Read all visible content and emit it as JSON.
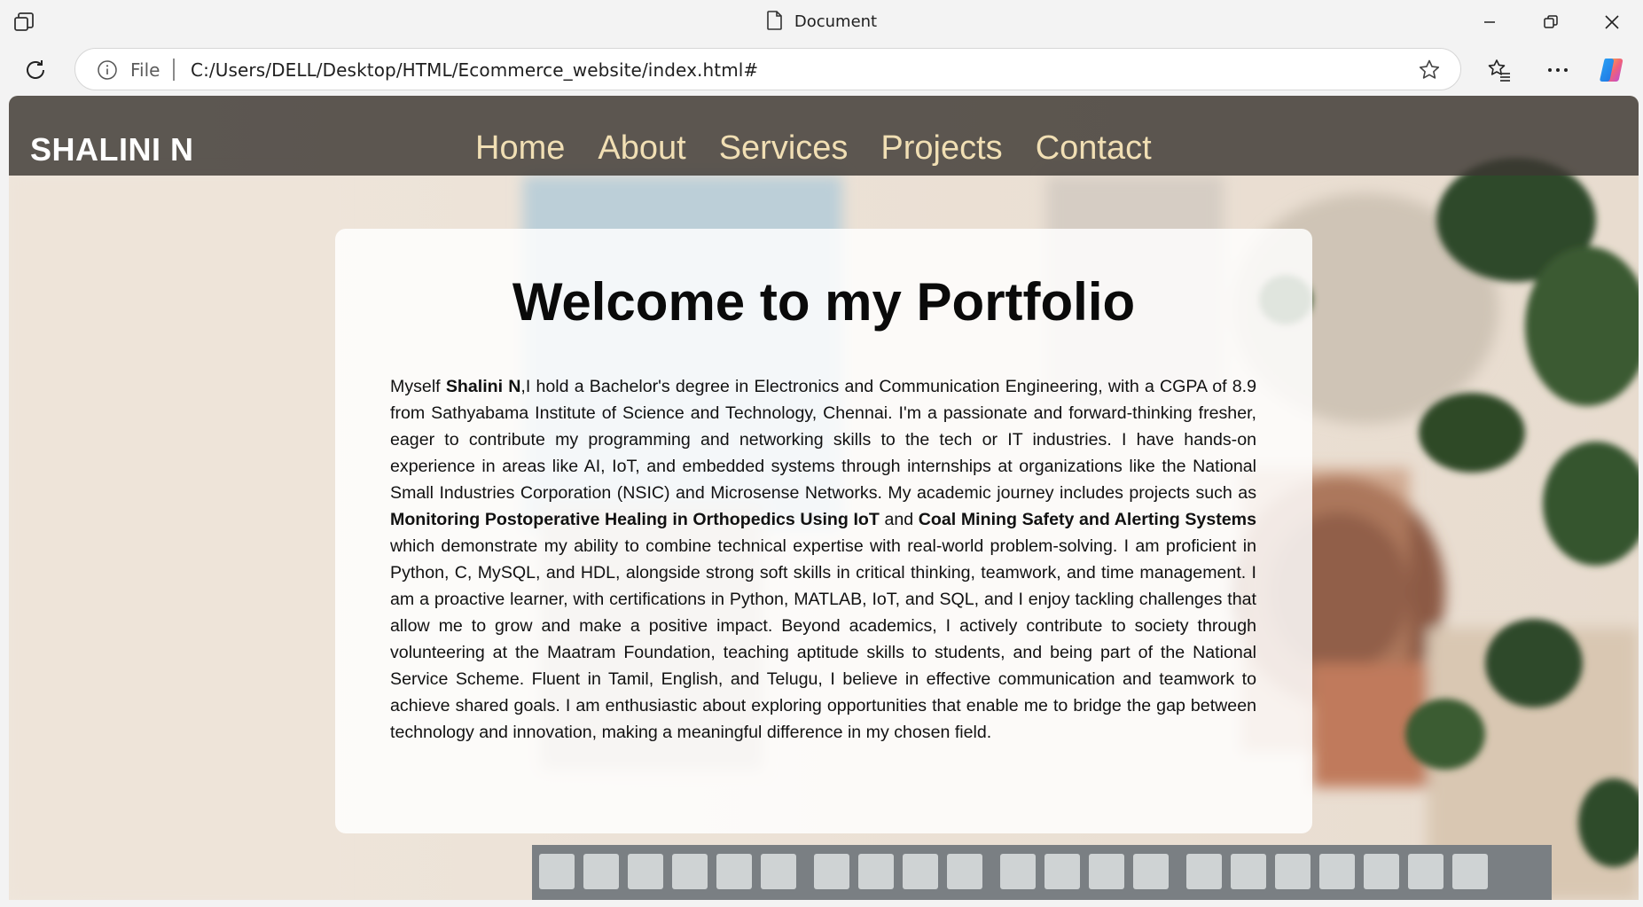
{
  "window": {
    "title": "Document"
  },
  "address_bar": {
    "scheme_label": "File",
    "url": "C:/Users/DELL/Desktop/HTML/Ecommerce_website/index.html#"
  },
  "page": {
    "brand": "SHALINI N",
    "nav": [
      "Home",
      "About",
      "Services",
      "Projects",
      "Contact"
    ],
    "heading": "Welcome to my Portfolio",
    "bio": {
      "t1": "Myself ",
      "b1": "Shalini N",
      "t2": ",I hold a Bachelor's degree in Electronics and Communication Engineering, with a CGPA of 8.9 from Sathyabama Institute of Science and Technology, Chennai. I'm a passionate and forward-thinking fresher, eager to contribute my programming and networking skills to the tech or IT industries. I have hands-on experience in areas like AI, IoT, and embedded systems through internships at organizations like the National Small Industries Corporation (NSIC) and Microsense Networks. My academic journey includes projects such as ",
      "b2": "Monitoring Postoperative Healing in Orthopedics Using IoT",
      "t3": " and ",
      "b3": "Coal Mining Safety and Alerting Systems",
      "t4": " which demonstrate my ability to combine technical expertise with real-world problem-solving. I am proficient in Python, C, MySQL, and HDL, alongside strong soft skills in critical thinking, teamwork, and time management. I am a proactive learner, with certifications in Python, MATLAB, IoT, and SQL, and I enjoy tackling challenges that allow me to grow and make a positive impact. Beyond academics, I actively contribute to society through volunteering at the Maatram Foundation, teaching aptitude skills to students, and being part of the National Service Scheme. Fluent in Tamil, English, and Telugu, I believe in effective communication and teamwork to achieve shared goals. I am enthusiastic about exploring opportunities that enable me to bridge the gap between technology and innovation, making a meaningful difference in my chosen field."
    }
  },
  "icons": {
    "window_left": "tabs-icon",
    "title": "document-icon",
    "reload": "reload-icon",
    "info": "info-icon",
    "favorite": "star-icon",
    "favorites_list": "favorites-icon",
    "menu": "more-icon",
    "copilot": "copilot-icon"
  },
  "colors": {
    "nav_link": "#f1dfb4",
    "brand": "#ffffff",
    "navbar_bg": "#3c3732"
  }
}
